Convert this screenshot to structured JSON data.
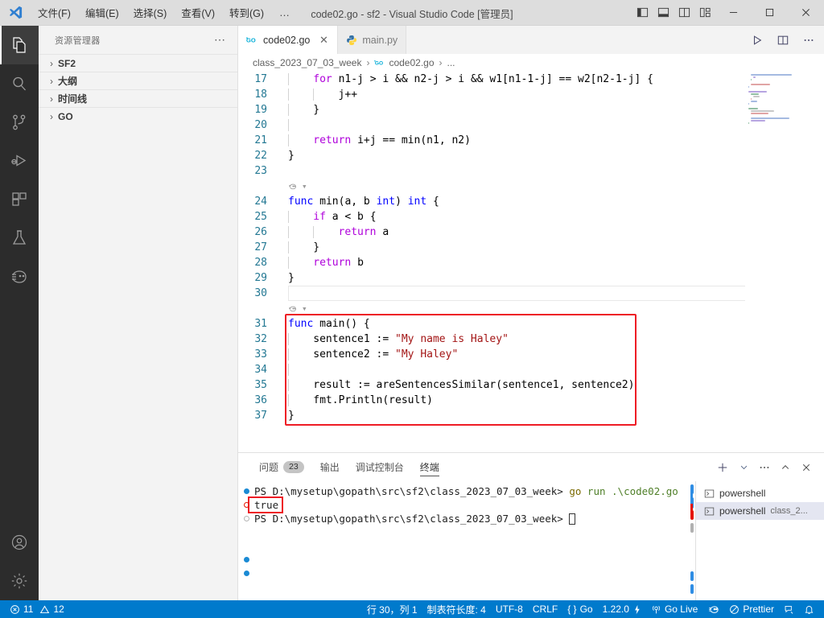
{
  "titlebar": {
    "logo_icon": "vscode-logo-icon",
    "menus": [
      {
        "label": "文件(F)",
        "name": "menu-file"
      },
      {
        "label": "编辑(E)",
        "name": "menu-edit"
      },
      {
        "label": "选择(S)",
        "name": "menu-selection"
      },
      {
        "label": "查看(V)",
        "name": "menu-view"
      },
      {
        "label": "转到(G)",
        "name": "menu-go"
      }
    ],
    "more_label": "…",
    "title": "code02.go - sf2 - Visual Studio Code [管理员]",
    "layout_buttons": [
      {
        "name": "toggle-primary-sidebar-icon",
        "label": "toggle-primary-sidebar"
      },
      {
        "name": "toggle-panel-icon",
        "label": "toggle-panel"
      },
      {
        "name": "toggle-secondary-sidebar-icon",
        "label": "toggle-secondary-sidebar"
      },
      {
        "name": "customize-layout-icon",
        "label": "customize-layout"
      }
    ],
    "window_buttons": [
      {
        "name": "window-minimize-button",
        "glyph": "—"
      },
      {
        "name": "window-maximize-button",
        "glyph": "☐"
      },
      {
        "name": "window-close-button",
        "glyph": "✕"
      }
    ]
  },
  "activitybar": {
    "items": [
      {
        "name": "activity-explorer",
        "icon": "files-icon",
        "active": true
      },
      {
        "name": "activity-search",
        "icon": "search-icon",
        "active": false
      },
      {
        "name": "activity-source-control",
        "icon": "source-control-icon",
        "active": false
      },
      {
        "name": "activity-run-debug",
        "icon": "run-and-debug-icon",
        "active": false
      },
      {
        "name": "activity-extensions",
        "icon": "extensions-icon",
        "active": false
      },
      {
        "name": "activity-testing",
        "icon": "beaker-icon",
        "active": false
      },
      {
        "name": "activity-go-extension",
        "icon": "go-gopher-icon",
        "active": false
      }
    ],
    "bottom": [
      {
        "name": "activity-accounts",
        "icon": "account-icon"
      },
      {
        "name": "activity-settings",
        "icon": "gear-icon"
      }
    ]
  },
  "sidebar": {
    "title": "资源管理器",
    "more_label": "⋯",
    "sections": [
      {
        "label": "SF2",
        "name": "sidebar-section-sf2"
      },
      {
        "label": "大纲",
        "name": "sidebar-section-outline"
      },
      {
        "label": "时间线",
        "name": "sidebar-section-timeline"
      },
      {
        "label": "GO",
        "name": "sidebar-section-go"
      }
    ]
  },
  "tabs": {
    "items": [
      {
        "label": "code02.go",
        "icon": "go-file-icon",
        "active": true,
        "close": "✕"
      },
      {
        "label": "main.py",
        "icon": "python-file-icon",
        "active": false,
        "close": ""
      }
    ],
    "actions": [
      {
        "name": "run-go-file-button",
        "icon": "play-icon"
      },
      {
        "name": "split-editor-right-button",
        "icon": "split-editor-icon"
      },
      {
        "name": "editor-more-actions-button",
        "icon": "ellipsis-icon"
      }
    ]
  },
  "breadcrumbs": {
    "items": [
      "class_2023_07_03_week",
      "code02.go",
      "..."
    ],
    "separator": "›",
    "file_icon": "go-file-icon"
  },
  "editor": {
    "first_line_number": 17,
    "lines": [
      {
        "n": 17,
        "indent": 1,
        "tokens": [
          {
            "t": "for ",
            "c": "ctrl"
          },
          {
            "t": "n1-j > i && n2-j > i && w1[n1-1-j] == w2[n2-1-j] {",
            "c": "punc"
          }
        ]
      },
      {
        "n": 18,
        "indent": 2,
        "tokens": [
          {
            "t": "j++",
            "c": "punc"
          }
        ]
      },
      {
        "n": 19,
        "indent": 1,
        "tokens": [
          {
            "t": "}",
            "c": "punc"
          }
        ]
      },
      {
        "n": 20,
        "indent": 1,
        "tokens": []
      },
      {
        "n": 21,
        "indent": 1,
        "tokens": [
          {
            "t": "return ",
            "c": "ctrl"
          },
          {
            "t": "i+j == ",
            "c": "punc"
          },
          {
            "t": "min",
            "c": "punc"
          },
          {
            "t": "(n1, n2)",
            "c": "punc"
          }
        ]
      },
      {
        "n": 22,
        "indent": 0,
        "tokens": [
          {
            "t": "}",
            "c": "punc"
          }
        ]
      },
      {
        "n": 23,
        "indent": 0,
        "tokens": []
      },
      {
        "n": 24,
        "indent": 0,
        "codelens": true,
        "tokens": [
          {
            "t": "func ",
            "c": "kw"
          },
          {
            "t": "min",
            "c": "punc"
          },
          {
            "t": "(a, b ",
            "c": "punc"
          },
          {
            "t": "int",
            "c": "kw"
          },
          {
            "t": ") ",
            "c": "punc"
          },
          {
            "t": "int",
            "c": "kw"
          },
          {
            "t": " {",
            "c": "punc"
          }
        ]
      },
      {
        "n": 25,
        "indent": 1,
        "tokens": [
          {
            "t": "if ",
            "c": "ctrl"
          },
          {
            "t": "a < b {",
            "c": "punc"
          }
        ]
      },
      {
        "n": 26,
        "indent": 2,
        "tokens": [
          {
            "t": "return ",
            "c": "ctrl"
          },
          {
            "t": "a",
            "c": "punc"
          }
        ]
      },
      {
        "n": 27,
        "indent": 1,
        "tokens": [
          {
            "t": "}",
            "c": "punc"
          }
        ]
      },
      {
        "n": 28,
        "indent": 1,
        "tokens": [
          {
            "t": "return ",
            "c": "ctrl"
          },
          {
            "t": "b",
            "c": "punc"
          }
        ]
      },
      {
        "n": 29,
        "indent": 0,
        "tokens": [
          {
            "t": "}",
            "c": "punc"
          }
        ]
      },
      {
        "n": 30,
        "indent": 0,
        "current": true,
        "tokens": []
      },
      {
        "n": 31,
        "indent": 0,
        "codelens": true,
        "boxstart": true,
        "tokens": [
          {
            "t": "func ",
            "c": "kw"
          },
          {
            "t": "main",
            "c": "punc"
          },
          {
            "t": "() {",
            "c": "punc"
          }
        ]
      },
      {
        "n": 32,
        "indent": 1,
        "tokens": [
          {
            "t": "sentence1 := ",
            "c": "punc"
          },
          {
            "t": "\"My name is Haley\"",
            "c": "str"
          }
        ]
      },
      {
        "n": 33,
        "indent": 1,
        "tokens": [
          {
            "t": "sentence2 := ",
            "c": "punc"
          },
          {
            "t": "\"My Haley\"",
            "c": "str"
          }
        ]
      },
      {
        "n": 34,
        "indent": 1,
        "tokens": []
      },
      {
        "n": 35,
        "indent": 1,
        "tokens": [
          {
            "t": "result := ",
            "c": "punc"
          },
          {
            "t": "areSentencesSimilar",
            "c": "punc"
          },
          {
            "t": "(sentence1, sentence2)",
            "c": "punc"
          }
        ]
      },
      {
        "n": 36,
        "indent": 1,
        "tokens": [
          {
            "t": "fmt.Println",
            "c": "punc"
          },
          {
            "t": "(result)",
            "c": "punc"
          }
        ]
      },
      {
        "n": 37,
        "indent": 0,
        "boxend": true,
        "tokens": [
          {
            "t": "}",
            "c": "punc"
          }
        ]
      }
    ],
    "codelens_glyph": "run-test-icon",
    "highlight_color": "#ee1c25"
  },
  "panel": {
    "tabs": [
      {
        "label": "问题",
        "badge": "23",
        "active": false,
        "name": "panel-tab-problems"
      },
      {
        "label": "输出",
        "badge": "",
        "active": false,
        "name": "panel-tab-output"
      },
      {
        "label": "调试控制台",
        "badge": "",
        "active": false,
        "name": "panel-tab-debug-console"
      },
      {
        "label": "终端",
        "badge": "",
        "active": true,
        "name": "panel-tab-terminal"
      }
    ],
    "actions": [
      {
        "name": "new-terminal-button",
        "icon": "plus-icon"
      },
      {
        "name": "terminal-profile-dropdown",
        "icon": "chevron-down-icon"
      },
      {
        "name": "panel-more-actions-button",
        "icon": "ellipsis-icon"
      },
      {
        "name": "maximize-panel-button",
        "icon": "chevron-up-icon"
      },
      {
        "name": "close-panel-button",
        "icon": "close-icon"
      }
    ],
    "terminal": {
      "lines": [
        {
          "marker": "blue",
          "segs": [
            {
              "t": "PS D:\\mysetup\\gopath\\src\\sf2\\class_2023_07_03_week> ",
              "c": ""
            },
            {
              "t": "go ",
              "c": "t-yellow"
            },
            {
              "t": "run .\\code02.go",
              "c": "t-green"
            }
          ]
        },
        {
          "marker": "err",
          "segs": [
            {
              "t": "true",
              "c": ""
            }
          ],
          "boxed": true
        },
        {
          "marker": "hollow",
          "segs": [
            {
              "t": "PS D:\\mysetup\\gopath\\src\\sf2\\class_2023_07_03_week> ",
              "c": ""
            }
          ],
          "cursor": true
        },
        {
          "marker": "none",
          "segs": []
        },
        {
          "marker": "none",
          "segs": []
        },
        {
          "marker": "blue",
          "segs": []
        },
        {
          "marker": "blue",
          "segs": []
        }
      ]
    },
    "terminal_tabs": [
      {
        "label": "powershell",
        "sub": "",
        "icon": "terminal-icon",
        "active": false,
        "mark": "#2f8de4"
      },
      {
        "label": "powershell",
        "sub": "class_2...",
        "icon": "terminal-icon",
        "active": true,
        "mark": "#e51400"
      }
    ]
  },
  "statusbar": {
    "left": [
      {
        "name": "status-problems",
        "icon": "error-icon",
        "label": "11",
        "icon2": "warning-icon",
        "label2": "12"
      }
    ],
    "right": [
      {
        "name": "status-cursor-position",
        "label": "行 30，列 1"
      },
      {
        "name": "status-indentation",
        "label": "制表符长度: 4"
      },
      {
        "name": "status-encoding",
        "label": "UTF-8"
      },
      {
        "name": "status-eol",
        "label": "CRLF"
      },
      {
        "name": "status-language-mode",
        "label": "Go",
        "icon": "braces-icon"
      },
      {
        "name": "status-go-version",
        "label": "1.22.0",
        "icon": "zap-icon"
      },
      {
        "name": "status-go-live",
        "label": "Go Live",
        "icon": "broadcast-icon"
      },
      {
        "name": "status-go-extension",
        "label": "",
        "icon": "go-gopher-icon"
      },
      {
        "name": "status-prettier",
        "label": "Prettier",
        "icon": "prettier-icon"
      },
      {
        "name": "status-remote",
        "label": "",
        "icon": "feedback-icon"
      },
      {
        "name": "status-notifications",
        "label": "",
        "icon": "bell-icon"
      }
    ]
  },
  "colors": {
    "accent": "#007acc",
    "highlight": "#ee1c25",
    "titlebar_bg": "#dddddd",
    "sidebar_bg": "#f3f3f3",
    "activitybar_bg": "#2c2c2c"
  }
}
